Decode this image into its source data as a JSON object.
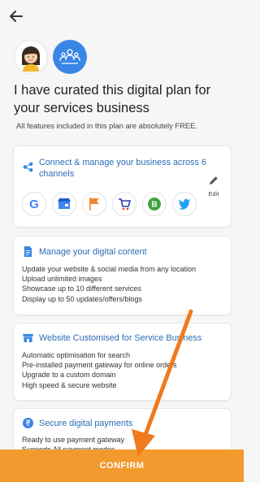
{
  "header": {
    "back_icon": "arrow-left-icon"
  },
  "avatars": {
    "user_icon": "user-avatar-icon",
    "team_icon": "team-icon"
  },
  "headline": "I have curated this digital plan for your services business",
  "subline": "All features included in this plan are absolutely FREE.",
  "cards": [
    {
      "title": "Connect & manage your business across 6 channels",
      "icon": "share-icon",
      "edit_label": "Edit",
      "channels": [
        {
          "name": "Google",
          "label": "G",
          "color": "#4285f4"
        },
        {
          "name": "Google My Business",
          "label": "GMB",
          "color": "#4285f4"
        },
        {
          "name": "Flag",
          "label": "Flag",
          "color": "#f2842a"
        },
        {
          "name": "Cart",
          "label": "Cart",
          "color": "#2b3aa8"
        },
        {
          "name": "B",
          "label": "B",
          "color": "#3fa33f"
        },
        {
          "name": "Twitter",
          "label": "Twitter",
          "color": "#1da1f2"
        }
      ]
    },
    {
      "title": "Manage your digital content",
      "icon": "document-icon",
      "items": [
        "Update your website & social media from any location",
        "Upload unlimited images",
        "Showcase up to 10 different services",
        "Display up to 50 updates/offers/blogs"
      ]
    },
    {
      "title": "Website Customised for Service Business",
      "icon": "store-icon",
      "items": [
        "Automatic optimisation for search",
        "Pre-installed payment gateway for online orders",
        "Upgrade to a custom domain",
        "High speed & secure website"
      ]
    },
    {
      "title": "Secure digital payments",
      "icon": "rupee-icon",
      "items": [
        "Ready to use payment gateway",
        "Supports All payment modes"
      ]
    }
  ],
  "confirm_label": "CONFIRM",
  "colors": {
    "accent": "#2b6db5",
    "confirm": "#f29a2e",
    "arrow": "#f07a1e"
  }
}
